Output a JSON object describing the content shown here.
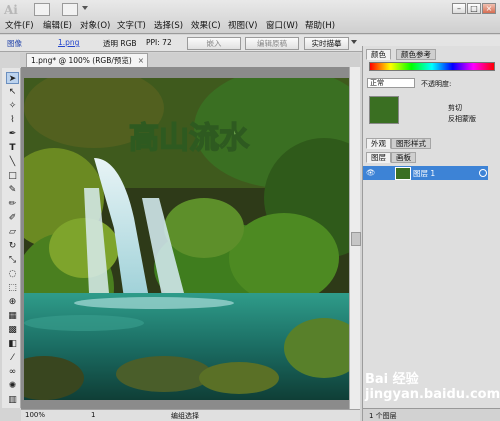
{
  "app": {
    "logo_text": "Ai"
  },
  "menu": {
    "items": [
      "文件(F)",
      "编辑(E)",
      "对象(O)",
      "文字(T)",
      "选择(S)",
      "效果(C)",
      "视图(V)",
      "窗口(W)",
      "帮助(H)"
    ]
  },
  "control_bar": {
    "image_label": "图像",
    "file_link": "1.png",
    "mode": "透明 RGB",
    "ppi": "PPI: 72",
    "embed_button": "嵌入",
    "edit_original_button": "编辑原稿",
    "live_trace_button": "实时描摹"
  },
  "document": {
    "tab_title": "1.png* @ 100% (RGB/预览)",
    "artwork_text": "高山流水"
  },
  "status_bar": {
    "zoom": "100%",
    "page": "1",
    "status_text": "编组选择"
  },
  "color_panel": {
    "tabs": [
      "颜色",
      "颜色参考"
    ]
  },
  "transparency_panel": {
    "blend_mode": "正常",
    "opacity_label": "不透明度:",
    "clip_label": "剪切",
    "invert_mask_label": "反相蒙版"
  },
  "appearance_panel": {
    "tabs": [
      "外观",
      "图形样式"
    ]
  },
  "layers_panel": {
    "tabs": [
      "图层",
      "画板"
    ],
    "layers": [
      {
        "name": "图层 1"
      }
    ],
    "footer_count": "1 个图层"
  },
  "colors": {
    "selection": "#3d83d6",
    "artwork_text": "#5a8f43"
  },
  "watermark": "Bai 经验 jingyan.baidu.com"
}
